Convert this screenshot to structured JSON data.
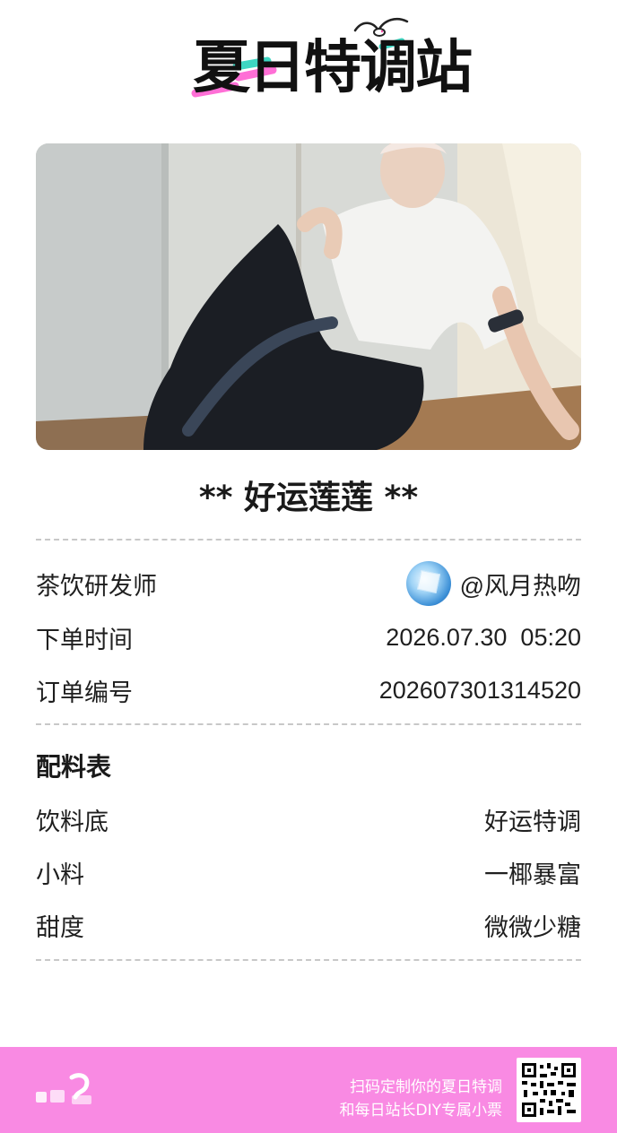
{
  "brand": {
    "logo_text": "夏日特调站"
  },
  "ticket": {
    "title": "** 好运莲莲 **"
  },
  "order": {
    "rows": [
      {
        "label": "茶饮研发师",
        "value": "@风月热吻"
      },
      {
        "label": "下单时间",
        "value": "2026.07.30  05:20"
      },
      {
        "label": "订单编号",
        "value": "202607301314520"
      }
    ]
  },
  "ingredients": {
    "heading": "配料表",
    "rows": [
      {
        "label": "饮料底",
        "value": "好运特调"
      },
      {
        "label": "小料",
        "value": "一椰暴富"
      },
      {
        "label": "甜度",
        "value": "微微少糖"
      }
    ]
  },
  "footer": {
    "line1": "扫码定制你的夏日特调",
    "line2": "和每日站长DIY专属小票",
    "background": "#f98ae3"
  },
  "icons": {
    "bird": "seagull-icon",
    "qr": "qr-code-icon",
    "avatar": "ice-cube-avatar"
  }
}
